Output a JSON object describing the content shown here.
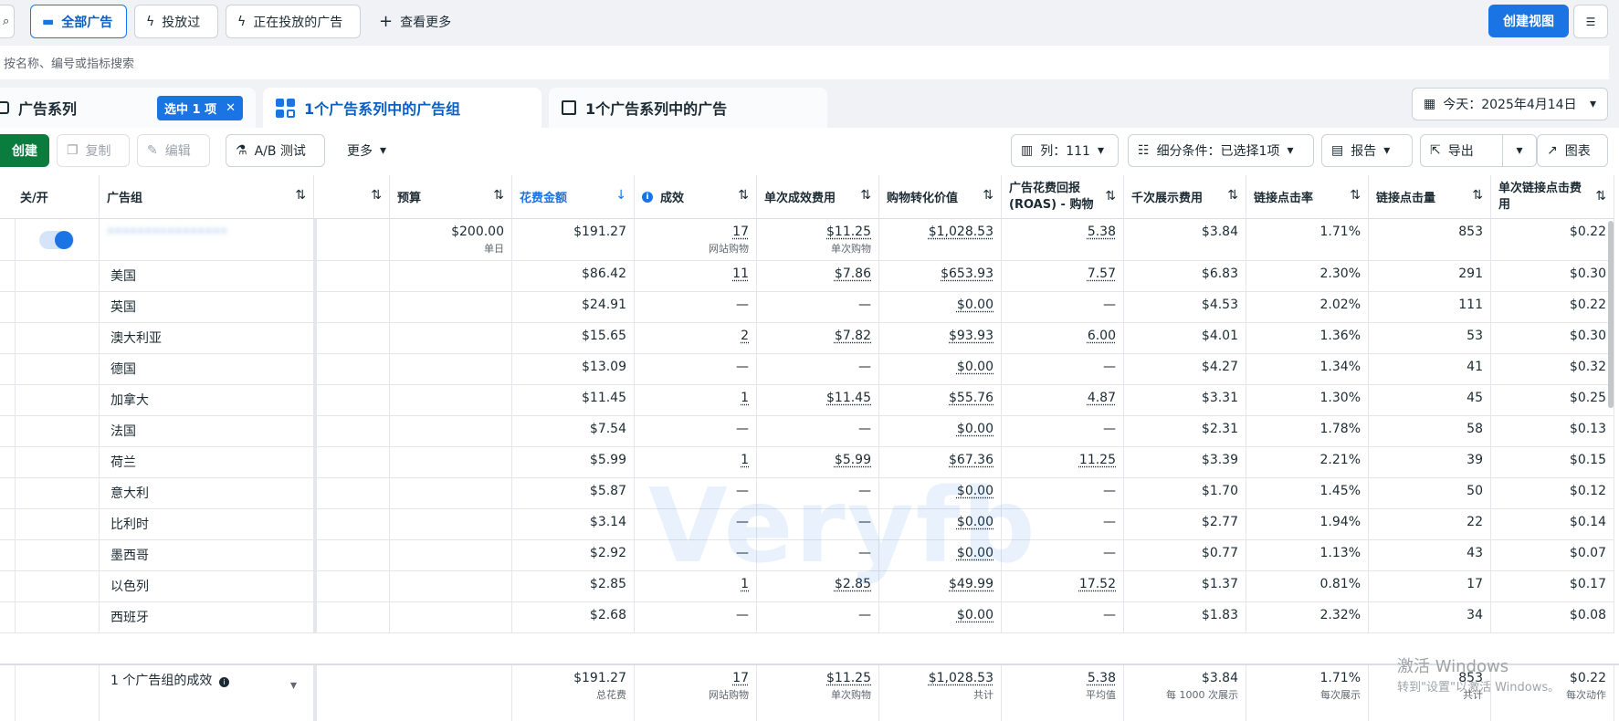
{
  "topbar": {
    "all_ads": "全部广告",
    "delivered": "投放过",
    "delivering": "正在投放的广告",
    "more": "查看更多",
    "create_view": "创建视图"
  },
  "search": {
    "placeholder": "按名称、编号或指标搜索"
  },
  "tabs": {
    "campaigns": "广告系列",
    "selected_badge": "选中 1 项",
    "adsets": "1个广告系列中的广告组",
    "ads": "1个广告系列中的广告",
    "date": "今天：2025年4月14日"
  },
  "toolbar": {
    "create": "创建",
    "copy": "复制",
    "edit": "编辑",
    "ab_test": "A/B 测试",
    "more": "更多",
    "columns": "列：111",
    "breakdown": "细分条件：已选择1项",
    "report": "报告",
    "export": "导出",
    "chart": "图表"
  },
  "headers": {
    "toggle": "关/开",
    "adset": "广告组",
    "budget": "预算",
    "spend": "花费金额",
    "results": "成效",
    "cost_per_result": "单次成效费用",
    "purchase_value": "购物转化价值",
    "roas": "广告花费回报 (ROAS) - 购物",
    "cpm": "千次展示费用",
    "ctr": "链接点击率",
    "clicks": "链接点击量",
    "cpc": "单次链接点击费用"
  },
  "summary_row": {
    "name": "••••••••••••••••",
    "budget": "$200.00",
    "budget_sub": "单日",
    "spend": "$191.27",
    "results": "17",
    "results_sub": "网站购物",
    "cost_per_result": "$11.25",
    "cost_sub": "单次购物",
    "purchase_value": "$1,028.53",
    "roas": "5.38",
    "cpm": "$3.84",
    "ctr": "1.71%",
    "clicks": "853",
    "cpc": "$0.22"
  },
  "rows": [
    {
      "country": "美国",
      "spend": "$86.42",
      "results": "11",
      "cpr": "$7.86",
      "value": "$653.93",
      "roas": "7.57",
      "cpm": "$6.83",
      "ctr": "2.30%",
      "clicks": "291",
      "cpc": "$0.30"
    },
    {
      "country": "英国",
      "spend": "$24.91",
      "results": "—",
      "cpr": "—",
      "value": "$0.00",
      "roas": "—",
      "cpm": "$4.53",
      "ctr": "2.02%",
      "clicks": "111",
      "cpc": "$0.22"
    },
    {
      "country": "澳大利亚",
      "spend": "$15.65",
      "results": "2",
      "cpr": "$7.82",
      "value": "$93.93",
      "roas": "6.00",
      "cpm": "$4.01",
      "ctr": "1.36%",
      "clicks": "53",
      "cpc": "$0.30"
    },
    {
      "country": "德国",
      "spend": "$13.09",
      "results": "—",
      "cpr": "—",
      "value": "$0.00",
      "roas": "—",
      "cpm": "$4.27",
      "ctr": "1.34%",
      "clicks": "41",
      "cpc": "$0.32"
    },
    {
      "country": "加拿大",
      "spend": "$11.45",
      "results": "1",
      "cpr": "$11.45",
      "value": "$55.76",
      "roas": "4.87",
      "cpm": "$3.31",
      "ctr": "1.30%",
      "clicks": "45",
      "cpc": "$0.25"
    },
    {
      "country": "法国",
      "spend": "$7.54",
      "results": "—",
      "cpr": "—",
      "value": "$0.00",
      "roas": "—",
      "cpm": "$2.31",
      "ctr": "1.78%",
      "clicks": "58",
      "cpc": "$0.13"
    },
    {
      "country": "荷兰",
      "spend": "$5.99",
      "results": "1",
      "cpr": "$5.99",
      "value": "$67.36",
      "roas": "11.25",
      "cpm": "$3.39",
      "ctr": "2.21%",
      "clicks": "39",
      "cpc": "$0.15"
    },
    {
      "country": "意大利",
      "spend": "$5.87",
      "results": "—",
      "cpr": "—",
      "value": "$0.00",
      "roas": "—",
      "cpm": "$1.70",
      "ctr": "1.45%",
      "clicks": "50",
      "cpc": "$0.12"
    },
    {
      "country": "比利时",
      "spend": "$3.14",
      "results": "—",
      "cpr": "—",
      "value": "$0.00",
      "roas": "—",
      "cpm": "$2.77",
      "ctr": "1.94%",
      "clicks": "22",
      "cpc": "$0.14"
    },
    {
      "country": "墨西哥",
      "spend": "$2.92",
      "results": "—",
      "cpr": "—",
      "value": "$0.00",
      "roas": "—",
      "cpm": "$0.77",
      "ctr": "1.13%",
      "clicks": "43",
      "cpc": "$0.07"
    },
    {
      "country": "以色列",
      "spend": "$2.85",
      "results": "1",
      "cpr": "$2.85",
      "value": "$49.99",
      "roas": "17.52",
      "cpm": "$1.37",
      "ctr": "0.81%",
      "clicks": "17",
      "cpc": "$0.17"
    },
    {
      "country": "西班牙",
      "spend": "$2.68",
      "results": "—",
      "cpr": "—",
      "value": "$0.00",
      "roas": "—",
      "cpm": "$1.83",
      "ctr": "2.32%",
      "clicks": "34",
      "cpc": "$0.08"
    }
  ],
  "footer": {
    "label": "1 个广告组的成效",
    "spend": "$191.27",
    "spend_sub": "总花费",
    "results": "17",
    "results_sub": "网站购物",
    "cpr": "$11.25",
    "cpr_sub": "单次购物",
    "value": "$1,028.53",
    "value_sub": "共计",
    "roas": "5.38",
    "roas_sub": "平均值",
    "cpm": "$3.84",
    "cpm_sub": "每 1000 次展示",
    "ctr": "1.71%",
    "ctr_sub": "每次展示",
    "clicks": "853",
    "clicks_sub": "共计",
    "cpc": "$0.22",
    "cpc_sub": "每次动作"
  },
  "watermark": "Veryfb",
  "windows": {
    "line1": "激活 Windows",
    "line2": "转到\"设置\"以激活 Windows。"
  }
}
